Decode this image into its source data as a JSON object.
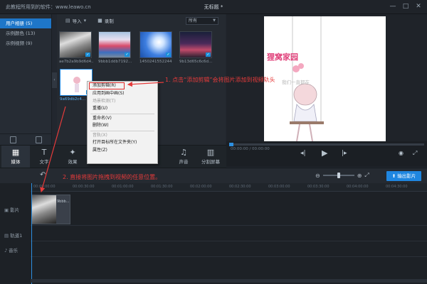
{
  "app": {
    "name": "此教程所用到的软件：www.leawo.cn",
    "doc_title": "无标题 *",
    "win_min": "—",
    "win_max": "□",
    "win_close": "✕"
  },
  "sidebar": {
    "items": [
      {
        "label": "用户相册 (5)"
      },
      {
        "label": "示例颜色 (13)"
      },
      {
        "label": "示例视频 (9)"
      }
    ]
  },
  "library": {
    "import_label": "导入",
    "record_label": "录制",
    "filter_value": "所有",
    "thumbs": [
      {
        "label": "ae7b2a9b9d6d4..."
      },
      {
        "label": "9bbb1ddb7192..."
      },
      {
        "label": "1450241552244"
      },
      {
        "label": "9b13d65c6c6d..."
      },
      {
        "label": "9a69db2c4..."
      }
    ]
  },
  "context_menu": {
    "items": [
      {
        "label": "添加剪辑(R)",
        "disabled": false
      },
      {
        "label": "应用到画中画(S)",
        "disabled": false
      },
      {
        "label": "场景检测(T)",
        "disabled": true
      },
      {
        "label": "重播(U)",
        "disabled": false
      },
      {
        "label": "重命名(V)",
        "disabled": false
      },
      {
        "label": "删除(W)",
        "disabled": false
      },
      {
        "label": "音轨(X)",
        "disabled": true
      },
      {
        "label": "打开目标所在文件夹(Y)",
        "disabled": false
      },
      {
        "label": "属性(Z)",
        "disabled": false
      }
    ]
  },
  "annotations": {
    "step1": "1. 点击“添加剪辑”会将图片添加到视频轨头",
    "step2": "2. 直接将图片拖拽到视频的任意位置。"
  },
  "preview": {
    "title": "狸窝家园",
    "subtitle": "我们一直都在",
    "timecode": "00:00:00 / 00:00:00"
  },
  "tabs": [
    {
      "label": "媒体",
      "icon": "media-icon"
    },
    {
      "label": "文字",
      "icon": "text-icon"
    },
    {
      "label": "效果",
      "icon": "effects-icon"
    },
    {
      "label": "",
      "icon": "overlay-icon"
    },
    {
      "label": "",
      "icon": "element-icon"
    },
    {
      "label": "过渡",
      "icon": "transition-icon"
    },
    {
      "label": "声音",
      "icon": "audio-icon"
    },
    {
      "label": "分割屏幕",
      "icon": "split-screen-icon"
    }
  ],
  "timeline": {
    "export_label": "输出影片",
    "ruler": [
      "00:00:00:00",
      "00:00:30:00",
      "00:01:00:00",
      "00:01:30:00",
      "00:02:00:00",
      "00:02:30:00",
      "00:03:00:00",
      "00:03:30:00",
      "00:04:00:00",
      "00:04:30:00"
    ],
    "tracks": [
      {
        "label": "影片"
      },
      {
        "label": "轨道1"
      },
      {
        "label": "音乐"
      }
    ],
    "clip_label": "9bbb..."
  },
  "colors": {
    "accent": "#1e76c8",
    "annotation": "#e63b3b",
    "title_pink": "#e0407a"
  }
}
